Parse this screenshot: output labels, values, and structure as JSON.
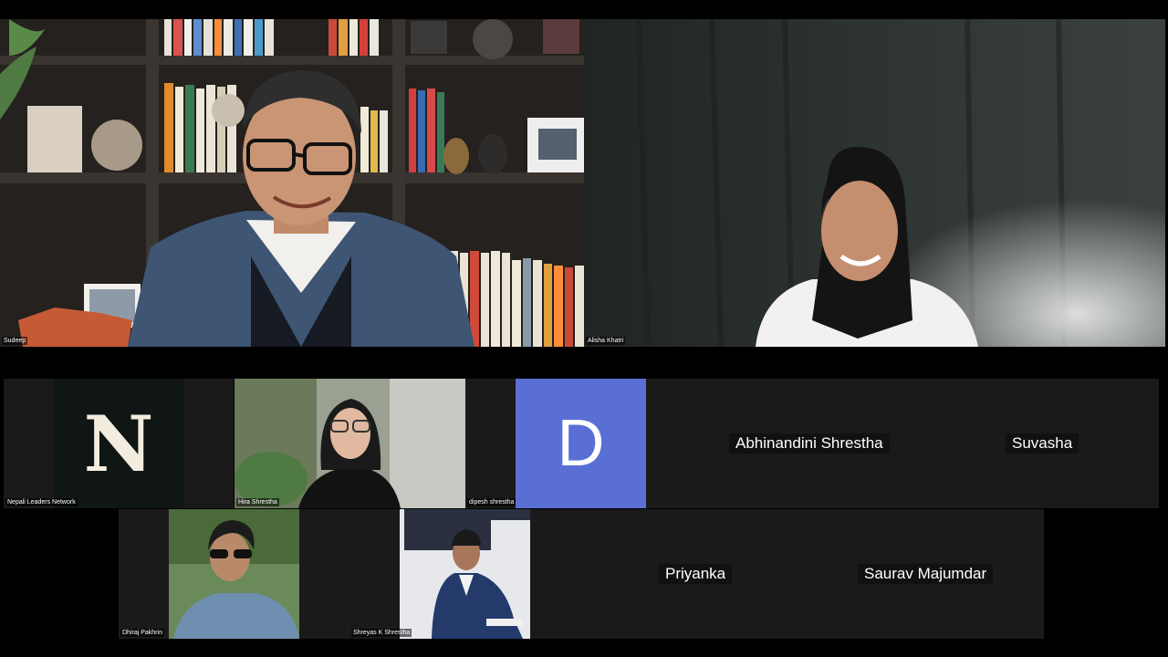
{
  "meeting": {
    "speakers": [
      {
        "name": "Sudeep"
      },
      {
        "name": "Alisha Khatri"
      }
    ],
    "gallery": [
      {
        "name": "Nepali Leaders Network",
        "avatar_letter": "N",
        "type": "avatar"
      },
      {
        "name": "Hira Shrestha",
        "type": "video"
      },
      {
        "name": "dipesh shrestha",
        "avatar_letter": "D",
        "type": "avatar"
      },
      {
        "name": "Abhinandini Shrestha",
        "type": "name-only"
      },
      {
        "name": "Suvasha",
        "type": "name-only"
      },
      {
        "name": "Dhiraj Pakhrin",
        "type": "video"
      },
      {
        "name": "Shreyas K Shrestha",
        "type": "video"
      },
      {
        "name": "Priyanka",
        "type": "name-only"
      },
      {
        "name": "Saurav Majumdar",
        "type": "name-only"
      }
    ]
  },
  "colors": {
    "background": "#000000",
    "tile": "#1a1a1a",
    "avatar_n_bg": "#0f1613",
    "avatar_d_bg": "#5a6fd6"
  }
}
